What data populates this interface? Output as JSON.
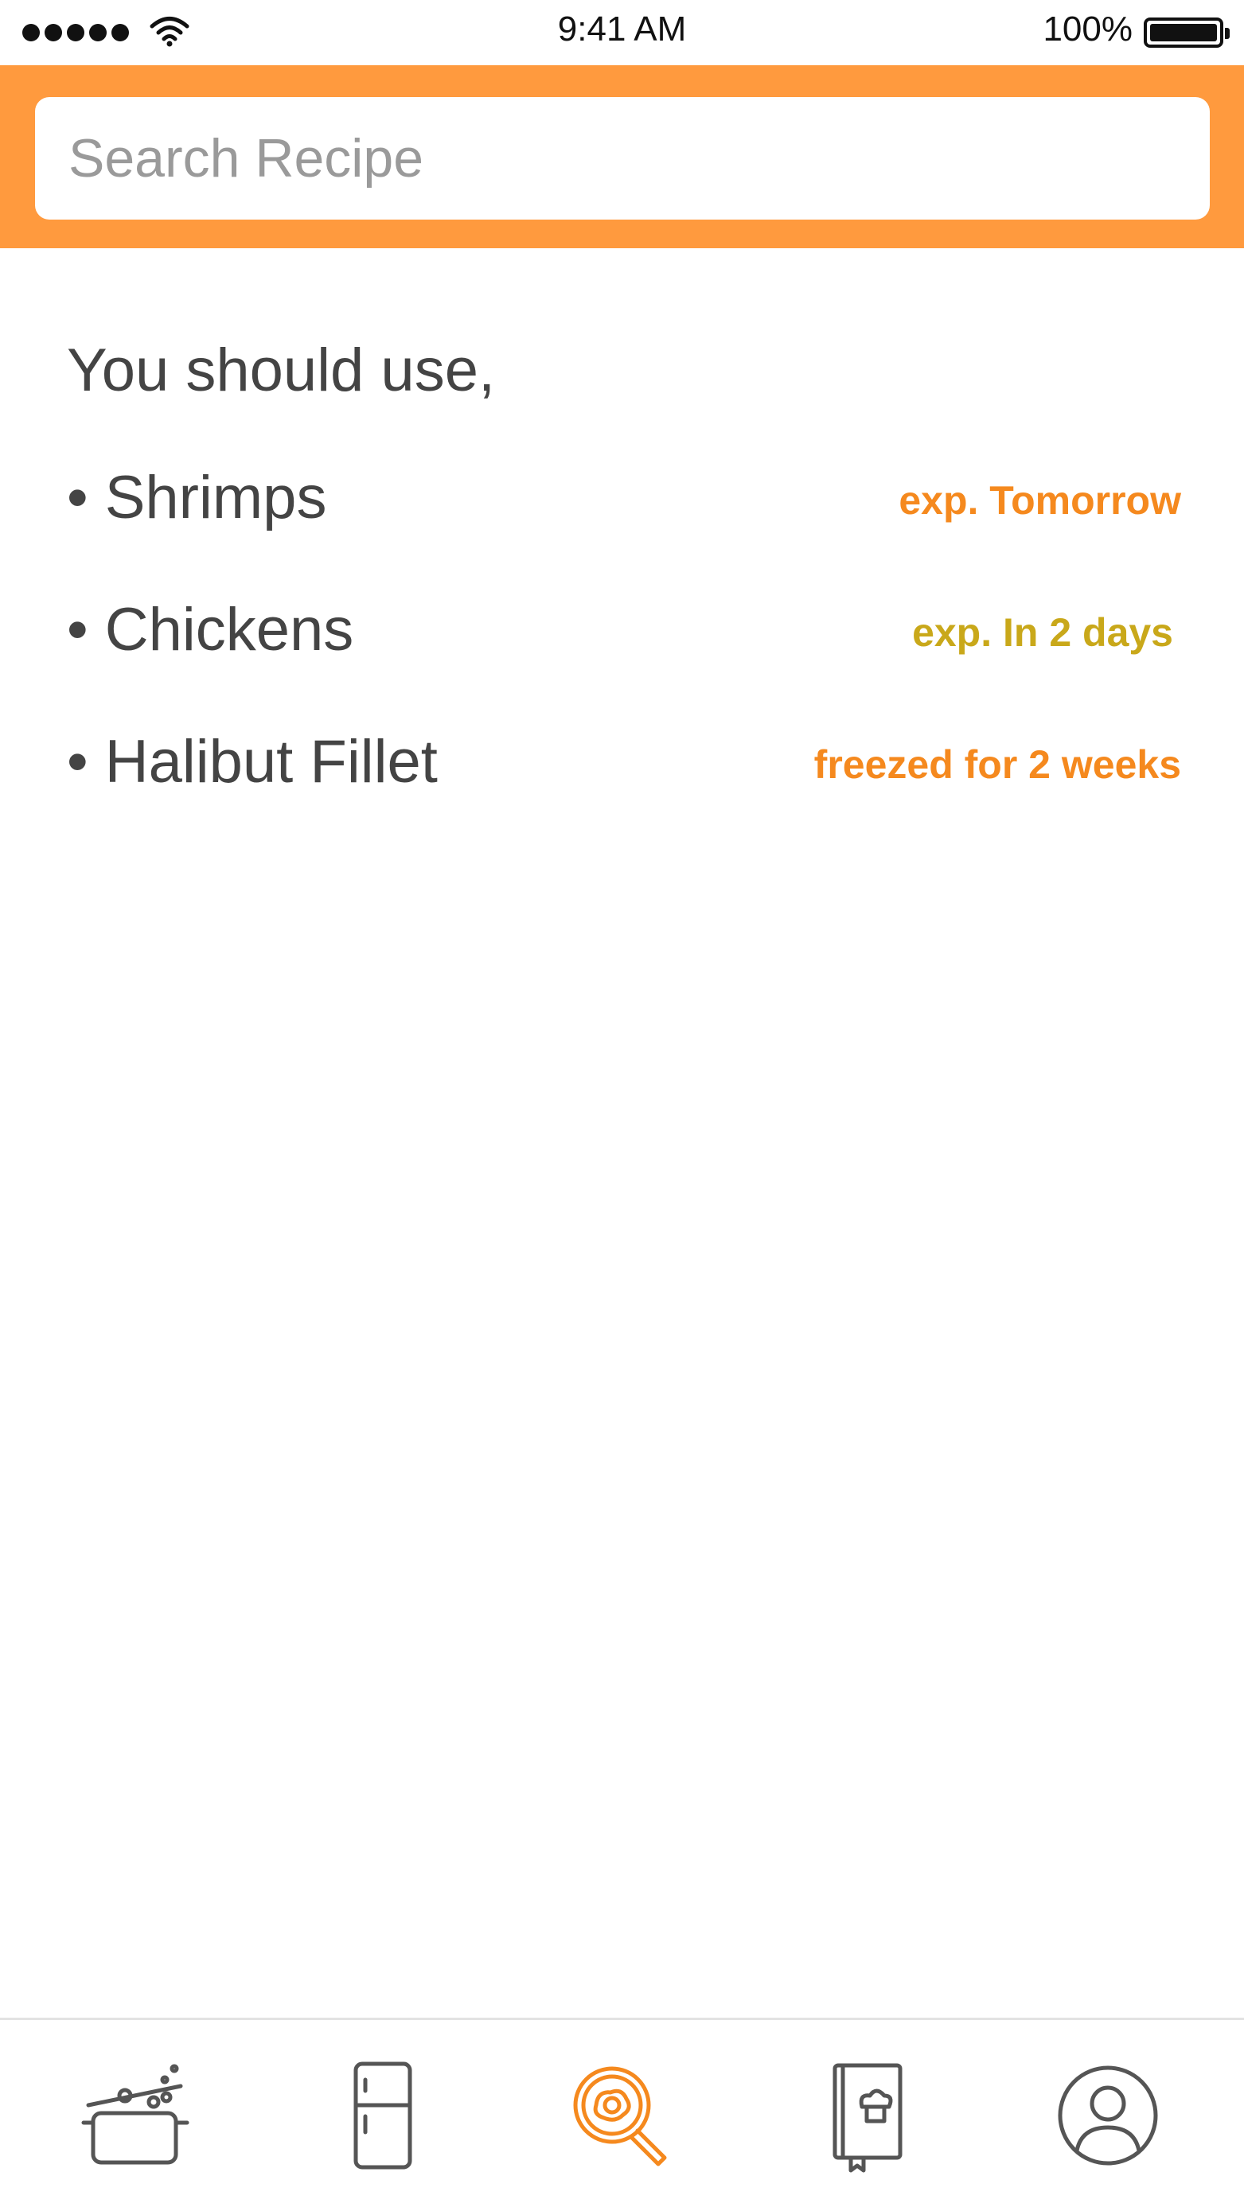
{
  "status_bar": {
    "time": "9:41 AM",
    "battery_percent": "100%",
    "battery_level": 1.0,
    "signal_icon": "signal-dots-icon",
    "wifi_icon": "wifi-icon",
    "battery_icon": "battery-icon"
  },
  "search": {
    "placeholder": "Search Recipe",
    "value": ""
  },
  "content": {
    "intro": "You should use,",
    "items": [
      {
        "name": "• Shrimps",
        "status": "exp. Tomorrow",
        "status_color": "#f5891e"
      },
      {
        "name": "• Chickens",
        "status": "exp. In 2 days",
        "status_color": "#c9a81a"
      },
      {
        "name": "• Halibut Fillet",
        "status": "freezed for 2 weeks",
        "status_color": "#f5891e"
      }
    ]
  },
  "tab_bar": {
    "tabs": [
      {
        "icon": "cooking-pot-icon",
        "active": false
      },
      {
        "icon": "fridge-icon",
        "active": false
      },
      {
        "icon": "search-recipe-icon",
        "active": true
      },
      {
        "icon": "recipe-book-icon",
        "active": false
      },
      {
        "icon": "profile-icon",
        "active": false
      }
    ],
    "active_color": "#f5891e",
    "inactive_color": "#555555"
  },
  "colors": {
    "header_orange": "#ff9a3e",
    "text_gray": "#444444"
  }
}
